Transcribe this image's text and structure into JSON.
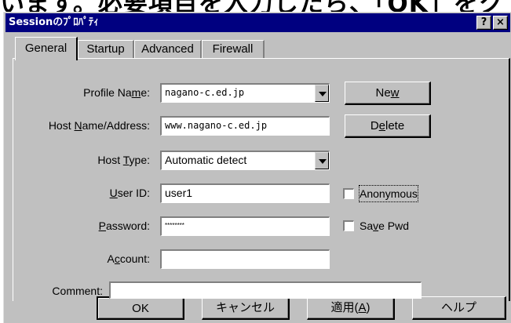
{
  "background": {
    "text": "います。必要項目を入力したら、「OK」をク"
  },
  "window": {
    "title": "Sessionのﾌﾟﾛﾊﾟﾃｨ",
    "help_btn": "?",
    "close_btn": "×"
  },
  "tabs": [
    {
      "label": "General",
      "active": true
    },
    {
      "label": "Startup"
    },
    {
      "label": "Advanced"
    },
    {
      "label": "Firewall"
    }
  ],
  "form": {
    "profile_name_pre": "Profile Na",
    "profile_name_ul": "m",
    "profile_name_post": "e:",
    "profile_name_value": "nagano-c.ed.jp",
    "host_pre": "Host ",
    "host_ul": "N",
    "host_post": "ame/Address:",
    "host_value": "www.nagano-c.ed.jp",
    "hosttype_pre": "Host ",
    "hosttype_ul": "T",
    "hosttype_post": "ype:",
    "hosttype_value": "Automatic detect",
    "userid_ul": "U",
    "userid_post": "ser ID:",
    "userid_value": "user1",
    "password_ul": "P",
    "password_post": "assword:",
    "password_value": "********",
    "account_pre": "A",
    "account_ul": "c",
    "account_post": "count:",
    "account_value": "",
    "comment_label": "Comment:",
    "comment_value": ""
  },
  "side_buttons": {
    "new_pre": "Ne",
    "new_ul": "w",
    "new_post": "",
    "delete_pre": "D",
    "delete_ul": "e",
    "delete_post": "lete"
  },
  "checks": {
    "anonymous_label": "Anonymous",
    "anonymous_checked": false,
    "savepwd_pre": "Sa",
    "savepwd_ul": "v",
    "savepwd_post": "e Pwd",
    "savepwd_checked": false
  },
  "bottom_buttons": {
    "ok": "OK",
    "cancel": "キャンセル",
    "apply_pre": "適用(",
    "apply_ul": "A",
    "apply_post": ")",
    "help": "ヘルプ"
  }
}
